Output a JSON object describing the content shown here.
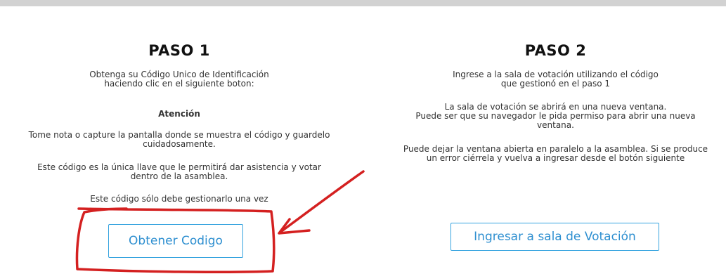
{
  "step1": {
    "title": "PASO 1",
    "intro_line1": "Obtenga su Código Unico de Identificación",
    "intro_line2": "haciendo clic en el siguiente boton:",
    "attention": "Atención",
    "note_line1": "Tome nota o capture la pantalla donde se muestra el código y guardelo",
    "note_line2": "cuidadosamente.",
    "key_line1": "Este código es la única llave que le permitirá dar asistencia y votar",
    "key_line2": "dentro de la asamblea.",
    "once": "Este código sólo debe gestionarlo una vez",
    "button_label": "Obtener Codigo"
  },
  "step2": {
    "title": "PASO 2",
    "intro_line1": "Ingrese a la sala de votación utilizando el código",
    "intro_line2": "que gestionó en el paso 1",
    "window_line1": "La sala de votación se abrirá en una nueva ventana.",
    "window_line2": "Puede ser que su navegador le pida permiso para abrir una nueva",
    "window_line3": "ventana.",
    "parallel_line1": "Puede dejar la ventana abierta en paralelo a la asamblea. Si se produce",
    "parallel_line2": "un error ciérrela y vuelva a ingresar desde el botón siguiente",
    "button_label": "Ingresar a sala de Votación"
  },
  "colors": {
    "accent": "#2e8fd0",
    "button_border": "#35a3df",
    "annotation_red": "#d42020",
    "top_bar": "#d2d2d2"
  }
}
